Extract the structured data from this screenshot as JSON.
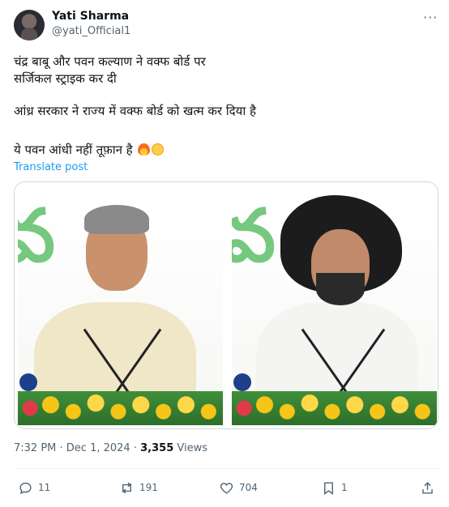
{
  "author": {
    "name": "Yati Sharma",
    "handle": "@yati_Official1"
  },
  "tweet": {
    "lines": [
      "चंद्र बाबू और पवन कल्याण ने वक्फ बोर्ड पर",
      "सर्जिकल स्ट्राइक कर दी",
      "आंध्र सरकार ने राज्य में वक्फ बोर्ड को खत्म कर दिया है",
      "ये पवन आंधी नहीं तूफ़ान है"
    ],
    "emojis": [
      "fire-emoji",
      "saluting-face-emoji"
    ],
    "translate_label": "Translate post"
  },
  "media": {
    "panels": [
      "speaker-left-photo",
      "speaker-right-photo"
    ]
  },
  "meta": {
    "time": "7:32 PM",
    "separator": " · ",
    "date": "Dec 1, 2024",
    "views_count": "3,355",
    "views_label": " Views"
  },
  "actions": {
    "replies": "11",
    "reposts": "191",
    "likes": "704",
    "bookmarks": "1"
  },
  "colors": {
    "link": "#1d9bf0",
    "secondary_text": "#536471",
    "primary_text": "#0f1419",
    "border": "#cfd9de"
  }
}
